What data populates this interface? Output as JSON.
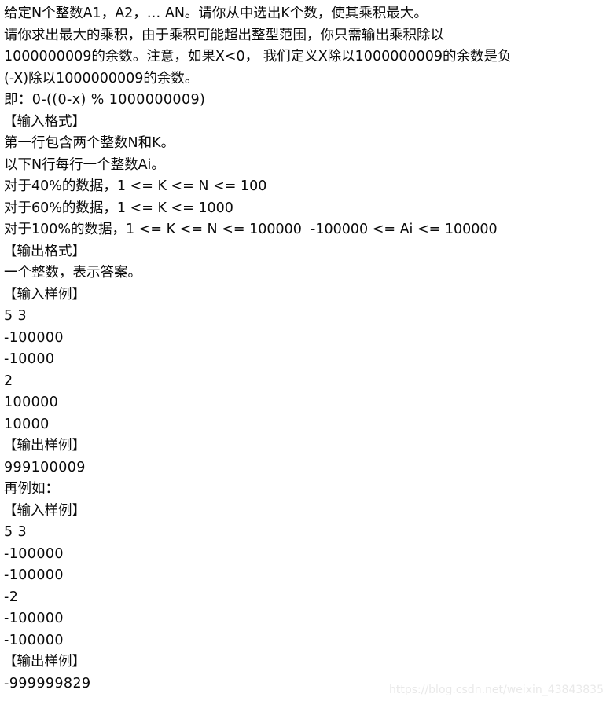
{
  "document": {
    "type": "programming-problem-statement",
    "lines": [
      {
        "id": "desc-1",
        "text": "给定N个整数A1，A2，… AN。请你从中选出K个数，使其乘积最大。",
        "style": "text"
      },
      {
        "id": "desc-2",
        "text": "请你求出最大的乘积，由于乘积可能超出整型范围，你只需输出乘积除以",
        "style": "text"
      },
      {
        "id": "desc-3",
        "text": "1000000009的余数。注意，如果X<0， 我们定义X除以1000000009的余数是负",
        "style": "text"
      },
      {
        "id": "desc-4",
        "text": "(-X)除以1000000009的余数。",
        "style": "text"
      },
      {
        "id": "desc-5",
        "text": "即：0-((0-x) % 1000000009)",
        "style": "mono"
      },
      {
        "id": "input-format-header",
        "text": "【输入格式】",
        "style": "bracket"
      },
      {
        "id": "input-format-1",
        "text": "第一行包含两个整数N和K。",
        "style": "text"
      },
      {
        "id": "input-format-2",
        "text": "以下N行每行一个整数Ai。",
        "style": "text"
      },
      {
        "id": "constraint-40",
        "text": "对于40%的数据，1 <= K <= N <= 100",
        "style": "text"
      },
      {
        "id": "constraint-60",
        "text": "对于60%的数据，1 <= K <= 1000",
        "style": "text"
      },
      {
        "id": "constraint-100",
        "text": "对于100%的数据，1 <= K <= N <= 100000  -100000 <= Ai <= 100000",
        "style": "text"
      },
      {
        "id": "output-format-header",
        "text": "【输出格式】",
        "style": "bracket"
      },
      {
        "id": "output-format-1",
        "text": "一个整数，表示答案。",
        "style": "text"
      },
      {
        "id": "input-sample-1-header",
        "text": "【输入样例】",
        "style": "bracket"
      },
      {
        "id": "in1-l1",
        "text": "5 3",
        "style": "mono"
      },
      {
        "id": "in1-l2",
        "text": "-100000",
        "style": "mono"
      },
      {
        "id": "in1-l3",
        "text": "-10000",
        "style": "mono"
      },
      {
        "id": "in1-l4",
        "text": "2",
        "style": "mono"
      },
      {
        "id": "in1-l5",
        "text": "100000",
        "style": "mono"
      },
      {
        "id": "in1-l6",
        "text": "10000",
        "style": "mono"
      },
      {
        "id": "output-sample-1-header",
        "text": "【输出样例】",
        "style": "bracket"
      },
      {
        "id": "out1-l1",
        "text": "999100009",
        "style": "mono"
      },
      {
        "id": "another-example-label",
        "text": "再例如：",
        "style": "text"
      },
      {
        "id": "input-sample-2-header",
        "text": "【输入样例】",
        "style": "bracket"
      },
      {
        "id": "in2-l1",
        "text": "5 3",
        "style": "mono"
      },
      {
        "id": "in2-l2",
        "text": "-100000",
        "style": "mono"
      },
      {
        "id": "in2-l3",
        "text": "-100000",
        "style": "mono"
      },
      {
        "id": "in2-l4",
        "text": "-2",
        "style": "mono"
      },
      {
        "id": "in2-l5",
        "text": "-100000",
        "style": "mono"
      },
      {
        "id": "in2-l6",
        "text": "-100000",
        "style": "mono"
      },
      {
        "id": "output-sample-2-header",
        "text": "【输出样例】",
        "style": "bracket"
      },
      {
        "id": "out2-l1",
        "text": "-999999829",
        "style": "mono"
      }
    ]
  },
  "watermark": {
    "text": "https://blog.csdn.net/weixin_43843835",
    "color": "#e9e9e9"
  },
  "colors": {
    "background": "#ffffff",
    "text": "#0a0a0a",
    "watermark": "#e9e9e9"
  }
}
